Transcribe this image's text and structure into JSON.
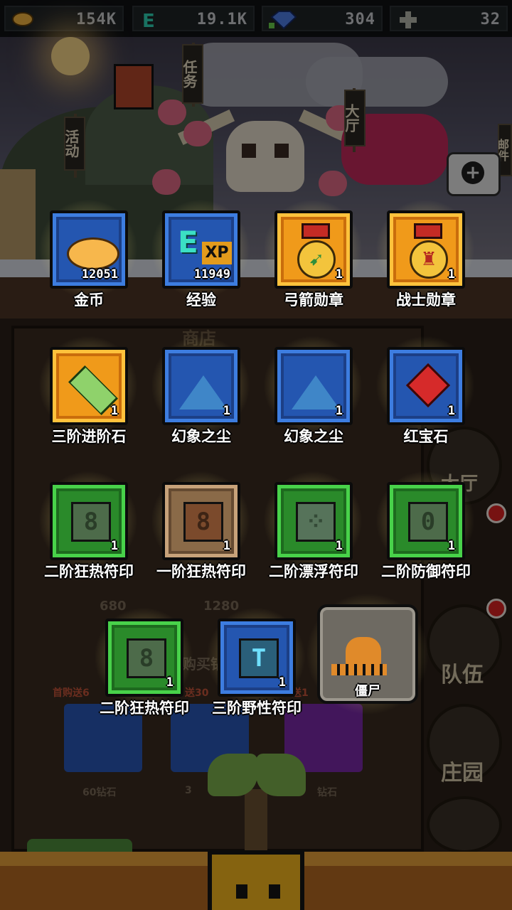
{
  "resources": {
    "gold": "154K",
    "exp": "19.1K",
    "diamond": "304",
    "cross": "32"
  },
  "scene": {
    "flags": [
      "任务",
      "活动",
      "大厅",
      "邮件"
    ],
    "shop_title": "商店",
    "side_buttons": [
      "大厅",
      "队伍",
      "庄园"
    ],
    "shop_prices": [
      "680",
      "1280"
    ],
    "shop_gem_labels": [
      "60钻石",
      "3",
      "钻石"
    ],
    "first_buy_text": [
      "首购送6",
      "送30",
      "送1"
    ],
    "buy_text": "购买钻"
  },
  "rewards": [
    {
      "name": "金币",
      "count": "12051",
      "frame": "blue",
      "art": "coin"
    },
    {
      "name": "经验",
      "count": "11949",
      "frame": "blue",
      "art": "exp"
    },
    {
      "name": "弓箭勋章",
      "count": "1",
      "frame": "orange",
      "art": "medal-bow"
    },
    {
      "name": "战士勋章",
      "count": "1",
      "frame": "orange",
      "art": "medal-warrior"
    },
    {
      "name": "三阶进阶石",
      "count": "1",
      "frame": "orange",
      "art": "crystal"
    },
    {
      "name": "幻象之尘",
      "count": "1",
      "frame": "blue",
      "art": "dust"
    },
    {
      "name": "幻象之尘",
      "count": "1",
      "frame": "blue",
      "art": "dust"
    },
    {
      "name": "红宝石",
      "count": "1",
      "frame": "blue",
      "art": "ruby"
    },
    {
      "name": "二阶狂热符印",
      "count": "1",
      "frame": "green",
      "art": "sigil-green",
      "glyph": "8"
    },
    {
      "name": "一阶狂热符印",
      "count": "1",
      "frame": "brown",
      "art": "sigil-brown",
      "glyph": "8"
    },
    {
      "name": "二阶漂浮符印",
      "count": "1",
      "frame": "green",
      "art": "sigil-green2",
      "glyph": "⁘"
    },
    {
      "name": "二阶防御符印",
      "count": "1",
      "frame": "green",
      "art": "sigil-green",
      "glyph": "0"
    },
    {
      "name": "二阶狂热符印",
      "count": "1",
      "frame": "green",
      "art": "sigil-green",
      "glyph": "8"
    },
    {
      "name": "三阶野性符印",
      "count": "1",
      "frame": "blue",
      "art": "sigil-teal",
      "glyph": "T"
    }
  ],
  "unit_card": {
    "name": "僵尸"
  },
  "colors": {
    "frame_blue": "#2456b0",
    "frame_orange": "#f09a1a",
    "frame_green": "#2a8a2a",
    "frame_brown": "#8a6a48",
    "label_text": "#ffffff",
    "ground": "#e7a23a"
  }
}
